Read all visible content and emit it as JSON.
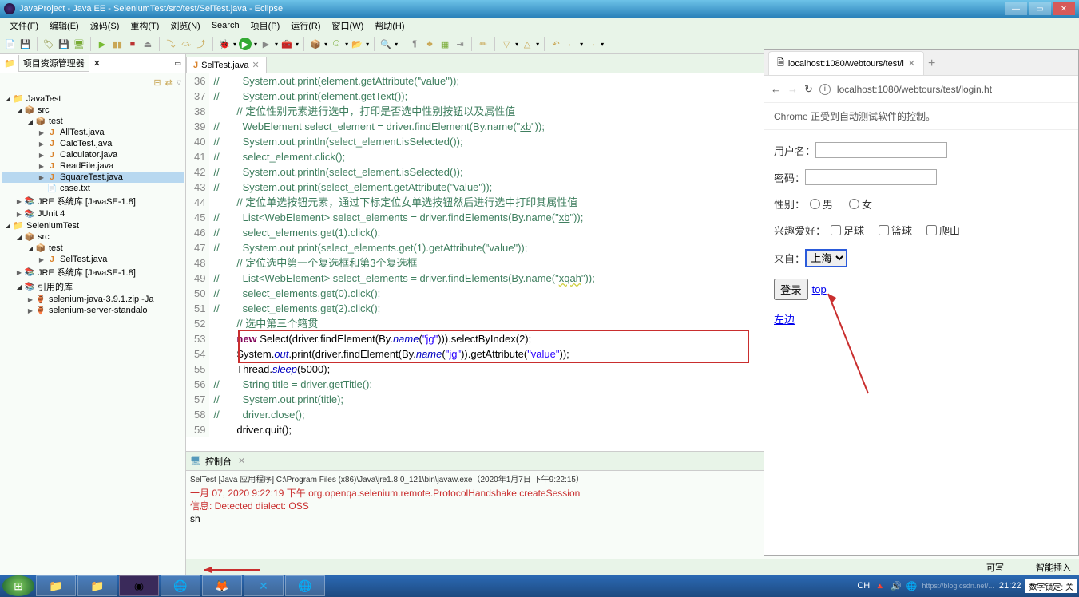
{
  "window": {
    "title": "JavaProject - Java EE - SeleniumTest/src/test/SelTest.java - Eclipse"
  },
  "menu": [
    "文件(F)",
    "编辑(E)",
    "源码(S)",
    "重构(T)",
    "浏览(N)",
    "Search",
    "项目(P)",
    "运行(R)",
    "窗口(W)",
    "帮助(H)"
  ],
  "explorer": {
    "title": "项目资源管理器",
    "tree": [
      {
        "lvl": 0,
        "arr": "▸",
        "ic": "ic-proj",
        "label": "JavaTest",
        "exp": true
      },
      {
        "lvl": 1,
        "arr": "▸",
        "ic": "ic-pkg",
        "label": "src",
        "exp": true
      },
      {
        "lvl": 2,
        "arr": "▸",
        "ic": "ic-pkg",
        "label": "test",
        "exp": true
      },
      {
        "lvl": 3,
        "arr": "▸",
        "ic": "ic-java",
        "label": "AllTest.java"
      },
      {
        "lvl": 3,
        "arr": "▸",
        "ic": "ic-java",
        "label": "CalcTest.java"
      },
      {
        "lvl": 3,
        "arr": "▸",
        "ic": "ic-java",
        "label": "Calculator.java"
      },
      {
        "lvl": 3,
        "arr": "▸",
        "ic": "ic-java",
        "label": "ReadFile.java"
      },
      {
        "lvl": 3,
        "arr": "▸",
        "ic": "ic-java",
        "label": "SquareTest.java",
        "sel": true
      },
      {
        "lvl": 3,
        "arr": "",
        "ic": "ic-txt",
        "label": "case.txt"
      },
      {
        "lvl": 1,
        "arr": "▸",
        "ic": "ic-lib",
        "label": "JRE 系统库 [JavaSE-1.8]"
      },
      {
        "lvl": 1,
        "arr": "▸",
        "ic": "ic-lib",
        "label": "JUnit 4"
      },
      {
        "lvl": 0,
        "arr": "▸",
        "ic": "ic-proj",
        "label": "SeleniumTest",
        "exp": true
      },
      {
        "lvl": 1,
        "arr": "▸",
        "ic": "ic-pkg",
        "label": "src",
        "exp": true
      },
      {
        "lvl": 2,
        "arr": "▸",
        "ic": "ic-pkg",
        "label": "test",
        "exp": true
      },
      {
        "lvl": 3,
        "arr": "▸",
        "ic": "ic-java",
        "label": "SelTest.java"
      },
      {
        "lvl": 1,
        "arr": "▸",
        "ic": "ic-lib",
        "label": "JRE 系统库 [JavaSE-1.8]"
      },
      {
        "lvl": 1,
        "arr": "▸",
        "ic": "ic-lib",
        "label": "引用的库",
        "exp": true
      },
      {
        "lvl": 2,
        "arr": "▸",
        "ic": "ic-jar",
        "label": "selenium-java-3.9.1.zip -Ja"
      },
      {
        "lvl": 2,
        "arr": "▸",
        "ic": "ic-jar",
        "label": "selenium-server-standalo"
      }
    ]
  },
  "editor": {
    "tab": "SelTest.java",
    "startLine": 36,
    "lines": [
      {
        "n": 36,
        "html": "<span class='com'>//        System.out.print(element.getAttribute(\"value\"));</span>"
      },
      {
        "n": 37,
        "html": "<span class='com'>//        System.out.print(element.getText());</span>"
      },
      {
        "n": 38,
        "html": "        <span class='com'>// 定位性别元素进行选中，打印是否选中性别按钮以及属性值</span>"
      },
      {
        "n": 39,
        "html": "<span class='com'>//        WebElement select_element = driver.findElement(By.name(\"<u>xb</u>\"));</span>"
      },
      {
        "n": 40,
        "html": "<span class='com'>//        System.out.println(select_element.isSelected());</span>"
      },
      {
        "n": 41,
        "html": "<span class='com'>//        select_element.click();</span>"
      },
      {
        "n": 42,
        "html": "<span class='com'>//        System.out.println(select_element.isSelected());</span>"
      },
      {
        "n": 43,
        "html": "<span class='com'>//        System.out.print(select_element.getAttribute(\"value\"));</span>"
      },
      {
        "n": 44,
        "html": "        <span class='com'>// 定位单选按钮元素，通过下标定位女单选按钮然后进行选中打印其属性值</span>"
      },
      {
        "n": 45,
        "html": "<span class='com'>//        List&lt;WebElement&gt; select_elements = driver.findElements(By.name(\"<u>xb</u>\"));</span>"
      },
      {
        "n": 46,
        "html": "<span class='com'>//        select_elements.get(1).click();</span>"
      },
      {
        "n": 47,
        "html": "<span class='com'>//        System.out.print(select_elements.get(1).getAttribute(\"value\"));</span>"
      },
      {
        "n": 48,
        "html": "        <span class='com'>// 定位选中第一个复选框和第3个复选框</span>"
      },
      {
        "n": 49,
        "html": "<span class='com'>//        List&lt;WebElement&gt; select_elements = driver.findElements(By.name(\"<span class='err'>xqah</span>\"));</span>"
      },
      {
        "n": 50,
        "html": "<span class='com'>//        select_elements.get(0).click();</span>"
      },
      {
        "n": 51,
        "html": "<span class='com'>//        select_elements.get(2).click();</span>"
      },
      {
        "n": 52,
        "html": "        <span class='com'>// 选中第三个籍贯</span>"
      },
      {
        "n": 53,
        "html": "        <span class='kw'>new</span> Select(driver.findElement(By.<span class='sfield'>name</span>(<span class='str'>\"<span class='err'>jg</span>\"</span>))).selectByIndex(2);"
      },
      {
        "n": 54,
        "html": "        System.<span class='sfield'>out</span>.print(driver.findElement(By.<span class='sfield'>name</span>(<span class='str'>\"<span class='err'>jg</span>\"</span>)).getAttribute(<span class='str'>\"value\"</span>));"
      },
      {
        "n": 55,
        "html": "        Thread.<span class='sfield'>sleep</span>(5000);"
      },
      {
        "n": 56,
        "html": "<span class='com'>//        String title = driver.getTitle();</span>"
      },
      {
        "n": 57,
        "html": "<span class='com'>//        System.out.print(title);</span>"
      },
      {
        "n": 58,
        "html": "<span class='com'>//        driver.close();</span>"
      },
      {
        "n": 59,
        "html": "        driver.quit();"
      }
    ]
  },
  "console": {
    "title": "控制台",
    "sub": "SelTest [Java 应用程序] C:\\Program Files (x86)\\Java\\jre1.8.0_121\\bin\\javaw.exe（2020年1月7日 下午9:22:15）",
    "line1": "一月 07, 2020 9:22:19 下午 org.openqa.selenium.remote.ProtocolHandshake createSession",
    "line2": "信息: Detected dialect: OSS",
    "line3": "sh"
  },
  "status": {
    "write": "可写",
    "insert": "智能插入"
  },
  "browser": {
    "tabTitle": "localhost:1080/webtours/test/l",
    "url": "localhost:1080/webtours/test/login.ht",
    "infobar": "Chrome 正受到自动测试软件的控制。",
    "labels": {
      "user": "用户名：",
      "pass": "密码：",
      "gender": "性别：",
      "male": "男",
      "female": "女",
      "hobby": "兴趣爱好：",
      "soccer": "足球",
      "basket": "篮球",
      "climb": "爬山",
      "from": "来自：",
      "selected": "上海",
      "login": "登录",
      "top": "top",
      "left": "左边"
    }
  },
  "tray": {
    "ime": "CH",
    "lock": "数字锁定: 关",
    "time": "21:22"
  },
  "watermark": "https://blog.csdn.net/..."
}
